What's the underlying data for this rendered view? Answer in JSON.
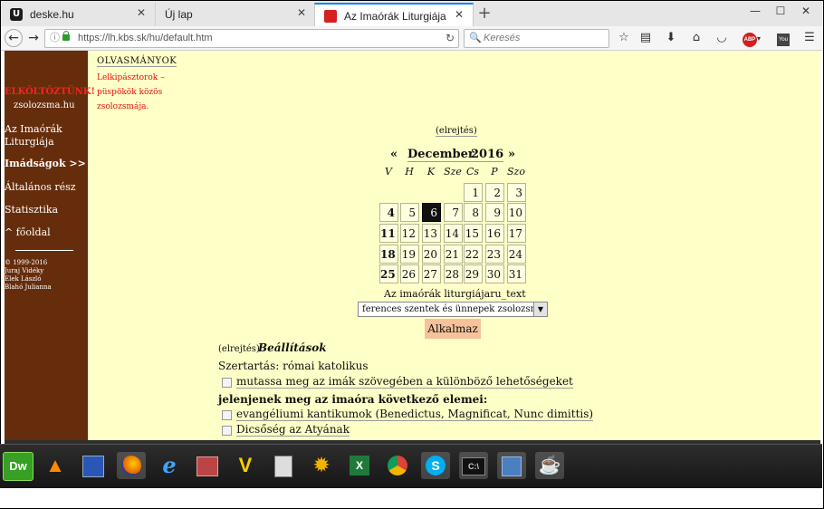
{
  "browser": {
    "tabs": [
      {
        "title": "deske.hu",
        "icon": "u-logo-icon"
      },
      {
        "title": "Új lap",
        "icon": "none"
      },
      {
        "title": "Az Imaórák Liturgiája",
        "icon": "red-square-icon",
        "active": true
      }
    ],
    "url": "https://lh.kbs.sk/hu/default.htm",
    "search_placeholder": "Keresés"
  },
  "sidebar": {
    "moved_notice": "ELKÖLTÖZTÜNK!",
    "site": "zsolozsma.hu",
    "links": [
      "Az Imaórák Liturgiája",
      "Imádságok >>",
      "Általános rész",
      "Statisztika",
      "^ főoldal"
    ],
    "copyright": [
      "© 1999-2016",
      "Juraj Vidéky",
      "Elek László",
      "Blahó Julianna"
    ]
  },
  "readings": {
    "title": "OLVASMÁNYOK",
    "subtitle": "Lelkipásztorok – püspökök közös zsolozsmája."
  },
  "calendar": {
    "hide_label": "(elrejtés)",
    "prev": "«",
    "month": "December",
    "year": "2016",
    "next": "»",
    "weekdays": [
      "V",
      "H",
      "K",
      "Sze",
      "Cs",
      "P",
      "Szo"
    ],
    "rows": [
      [
        "",
        "",
        "",
        "",
        "1",
        "2",
        "3"
      ],
      [
        "4",
        "5",
        "6",
        "7",
        "8",
        "9",
        "10"
      ],
      [
        "11",
        "12",
        "13",
        "14",
        "15",
        "16",
        "17"
      ],
      [
        "18",
        "19",
        "20",
        "21",
        "22",
        "23",
        "24"
      ],
      [
        "25",
        "26",
        "27",
        "28",
        "29",
        "30",
        "31"
      ]
    ],
    "selected_day": "6"
  },
  "liturgy": {
    "label": "Az imaórák liturgiájaru_text",
    "selected": "ferences szentek és ünnepek zsolozsmája",
    "apply": "Alkalmaz"
  },
  "settings": {
    "hide_label": "(elrejtés)",
    "title": "Beállítások",
    "rite": "Szertartás: római katolikus",
    "option1": "mutassa meg az imák szövegében a különböző lehetőségeket",
    "elements_heading": "jelenjenek meg az imaóra következő elemei:",
    "option2": "evangéliumi kantikumok (Benedictus, Magnificat, Nunc dimittis)",
    "option3": "Dicsőség az Atyának"
  },
  "taskbar": {
    "apps": [
      "dreamweaver-icon",
      "vlc-icon",
      "save-disk-icon",
      "firefox-icon",
      "internet-explorer-icon",
      "filmstrip-icon",
      "vectorian-icon",
      "calculator-icon",
      "bug-icon",
      "excel-icon",
      "chrome-icon",
      "skype-icon",
      "terminal-icon",
      "network-icon",
      "java-icon"
    ]
  }
}
